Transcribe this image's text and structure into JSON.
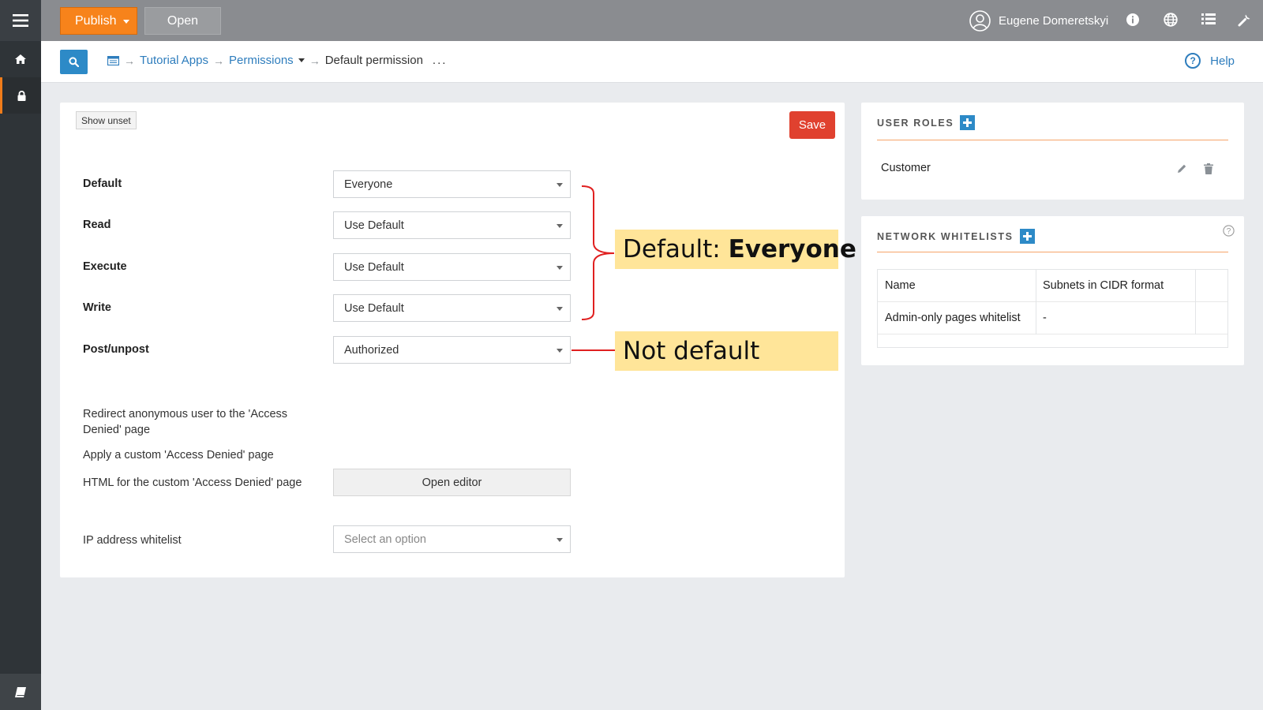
{
  "topbar": {
    "publish_label": "Publish",
    "open_label": "Open",
    "user_name": "Eugene Domeretskyi"
  },
  "breadcrumb": {
    "items": [
      "Tutorial Apps",
      "Permissions",
      "Default permission"
    ],
    "more": "..."
  },
  "help_label": "Help",
  "form": {
    "show_unset_label": "Show unset",
    "save_label": "Save",
    "fields": [
      {
        "label": "Default",
        "value": "Everyone"
      },
      {
        "label": "Read",
        "value": "Use Default"
      },
      {
        "label": "Execute",
        "value": "Use Default"
      },
      {
        "label": "Write",
        "value": "Use Default"
      },
      {
        "label": "Post/unpost",
        "value": "Authorized"
      }
    ],
    "redirect_label": "Redirect anonymous user to the 'Access Denied' page",
    "custom_page_label": "Apply a custom 'Access Denied' page",
    "html_label": "HTML for the custom 'Access Denied' page",
    "open_editor_label": "Open editor",
    "ip_whitelist_label": "IP address whitelist",
    "ip_whitelist_placeholder": "Select an option"
  },
  "annotations": {
    "default_prefix": "Default:",
    "default_value": "Everyone",
    "not_default": "Not default",
    "color": "#ffe599",
    "line_color": "#e02020"
  },
  "user_roles": {
    "title": "USER ROLES",
    "items": [
      "Customer"
    ]
  },
  "network_whitelists": {
    "title": "NETWORK WHITELISTS",
    "columns": [
      "Name",
      "Subnets in CIDR format"
    ],
    "rows": [
      [
        "Admin-only pages whitelist",
        "-"
      ]
    ]
  },
  "colors": {
    "accent_orange": "#f7831b",
    "accent_blue": "#2d8ac7",
    "save_red": "#e0412f",
    "topbar_gray": "#8a8c90",
    "rail_dark": "#2f3438"
  }
}
